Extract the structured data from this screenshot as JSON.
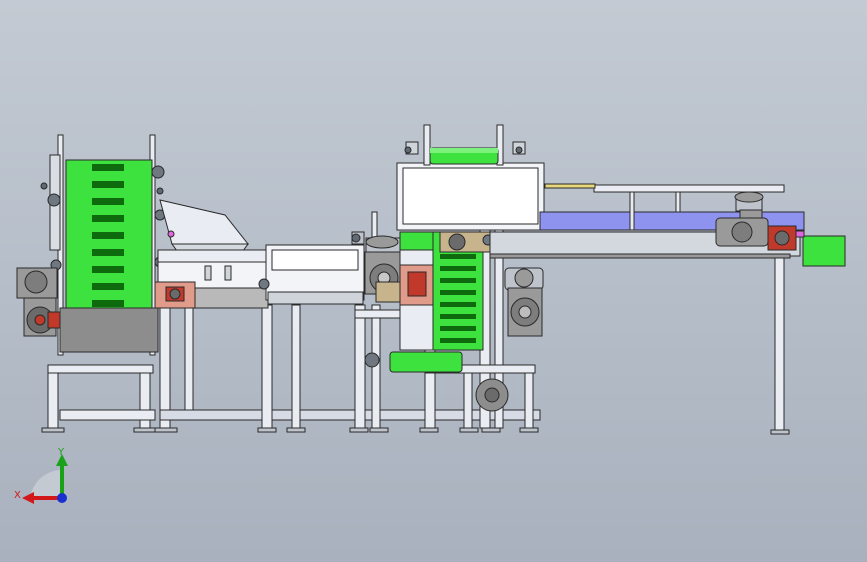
{
  "viewport": {
    "background_top": "#c3cad3",
    "background_bottom": "#a8b1bd"
  },
  "triad": {
    "x_label": "X",
    "y_label": "Y",
    "x_color": "#d21818",
    "y_color": "#1aa11a",
    "z_color": "#1a2fd0"
  },
  "colors": {
    "belt_green": "#3ee23e",
    "slat_dark": "#0d6b0d",
    "frame_light": "#e9edf3",
    "frame_outline": "#2a2a2a",
    "plate_grey": "#8d8d8d",
    "conveyor_blue": "#8f93f0",
    "gearbox_red": "#c0392b",
    "motor_grey": "#9a9a9a"
  }
}
